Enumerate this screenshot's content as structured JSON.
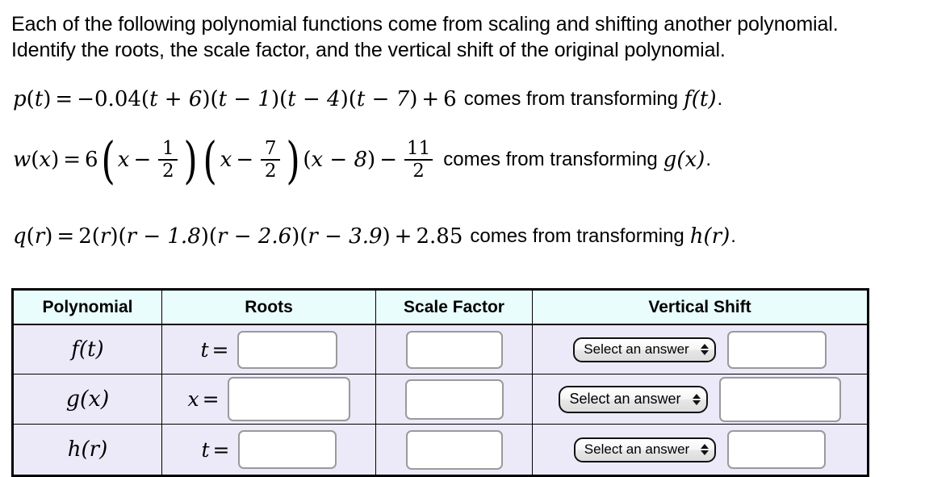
{
  "prompt": {
    "line1": "Each of the following polynomial functions come from scaling and shifting another polynomial.",
    "line2": "Identify the roots, the scale factor, and the vertical shift of the original polynomial."
  },
  "equations": [
    {
      "id": "p",
      "lhs_fn": "p",
      "lhs_var": "t",
      "expression": "p(t) = − 0.04(t + 6)(t − 1)(t − 4)(t − 7) + 6",
      "lead_coefficient": "0.04",
      "lead_sign": "−",
      "factors": [
        "t + 6",
        "t − 1",
        "t − 4",
        "t − 7"
      ],
      "constant_sign": "+",
      "constant": "6",
      "tail_text": "comes from transforming",
      "tail_fn": "f",
      "tail_var": "t",
      "tail_punct": "."
    },
    {
      "id": "w",
      "lhs_fn": "w",
      "lhs_var": "x",
      "expression": "w(x) = 6(x − 1/2)(x − 7/2)(x − 8) − 11/2",
      "lead_coefficient": "6",
      "factor1_var": "x",
      "factor1_num": "1",
      "factor1_den": "2",
      "factor2_var": "x",
      "factor2_num": "7",
      "factor2_den": "2",
      "factor3": "x − 8",
      "constant_sign": "−",
      "constant_num": "11",
      "constant_den": "2",
      "tail_text": "comes from transforming",
      "tail_fn": "g",
      "tail_var": "x",
      "tail_punct": "."
    },
    {
      "id": "q",
      "lhs_fn": "q",
      "lhs_var": "r",
      "expression": "q(r) = 2(r)(r − 1.8)(r − 2.6)(r − 3.9) + 2.85",
      "lead_coefficient": "2",
      "factors": [
        "r",
        "r − 1.8",
        "r − 2.6",
        "r − 3.9"
      ],
      "constant_sign": "+",
      "constant": "2.85",
      "tail_text": "comes from transforming",
      "tail_fn": "h",
      "tail_var": "r",
      "tail_punct": "."
    }
  ],
  "table": {
    "headers": {
      "polynomial": "Polynomial",
      "roots": "Roots",
      "scale_factor": "Scale Factor",
      "vertical_shift": "Vertical Shift"
    },
    "rows": [
      {
        "polynomial_fn": "f",
        "polynomial_var": "t",
        "root_var": "t",
        "root_eq": "=",
        "roots_value": "",
        "roots_placeholder": "",
        "scale_value": "",
        "scale_placeholder": "",
        "shift_select_label": "Select an answer",
        "shift_value": "",
        "shift_placeholder": ""
      },
      {
        "polynomial_fn": "g",
        "polynomial_var": "x",
        "root_var": "x",
        "root_eq": "=",
        "roots_value": "",
        "roots_placeholder": "",
        "scale_value": "",
        "scale_placeholder": "",
        "shift_select_label": "Select an answer",
        "shift_value": "",
        "shift_placeholder": ""
      },
      {
        "polynomial_fn": "h",
        "polynomial_var": "r",
        "root_var": "t",
        "root_eq": "=",
        "roots_value": "",
        "roots_placeholder": "",
        "scale_value": "",
        "scale_placeholder": "",
        "shift_select_label": "Select an answer",
        "shift_value": "",
        "shift_placeholder": ""
      }
    ]
  },
  "colors": {
    "header_bg": "#e9fdfd",
    "row_bg": "#eceaf9",
    "border": "#000000",
    "input_border": "#9a9a9a",
    "page_bg": "#ffffff"
  }
}
